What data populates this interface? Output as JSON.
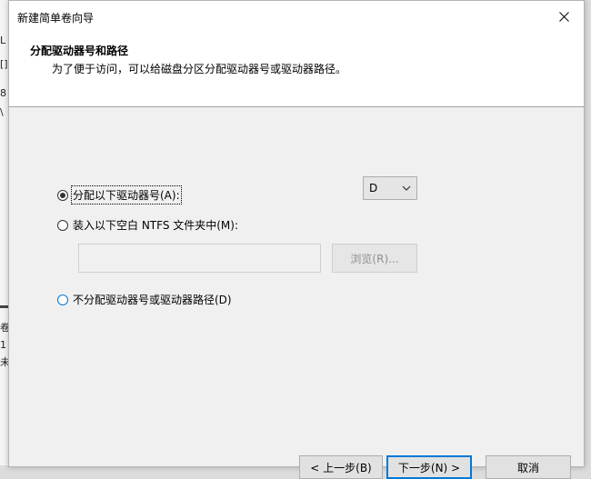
{
  "background_window": {
    "fragments": [
      "L",
      "[]",
      "8",
      "\\",
      "卷",
      "1",
      "未"
    ]
  },
  "dialog": {
    "title": "新建简单卷向导",
    "header": {
      "title": "分配驱动器号和路径",
      "description": "为了便于访问，可以给磁盘分区分配驱动器号或驱动器路径。"
    },
    "options": {
      "assign_letter": {
        "label": "分配以下驱动器号(A):",
        "checked": true
      },
      "mount_folder": {
        "label": "装入以下空白 NTFS 文件夹中(M):",
        "checked": false
      },
      "no_assign": {
        "label": "不分配驱动器号或驱动器路径(D)",
        "checked": false
      }
    },
    "drive_letter": {
      "selected": "D"
    },
    "folder_path": {
      "value": "",
      "placeholder": ""
    },
    "browse_label": "浏览(R)...",
    "footer_buttons": {
      "back": "< 上一步(B)",
      "next": "下一步(N) >",
      "cancel": "取消"
    }
  },
  "colors": {
    "accent": "#0078d7",
    "disabled_text": "#8f8f8f"
  }
}
